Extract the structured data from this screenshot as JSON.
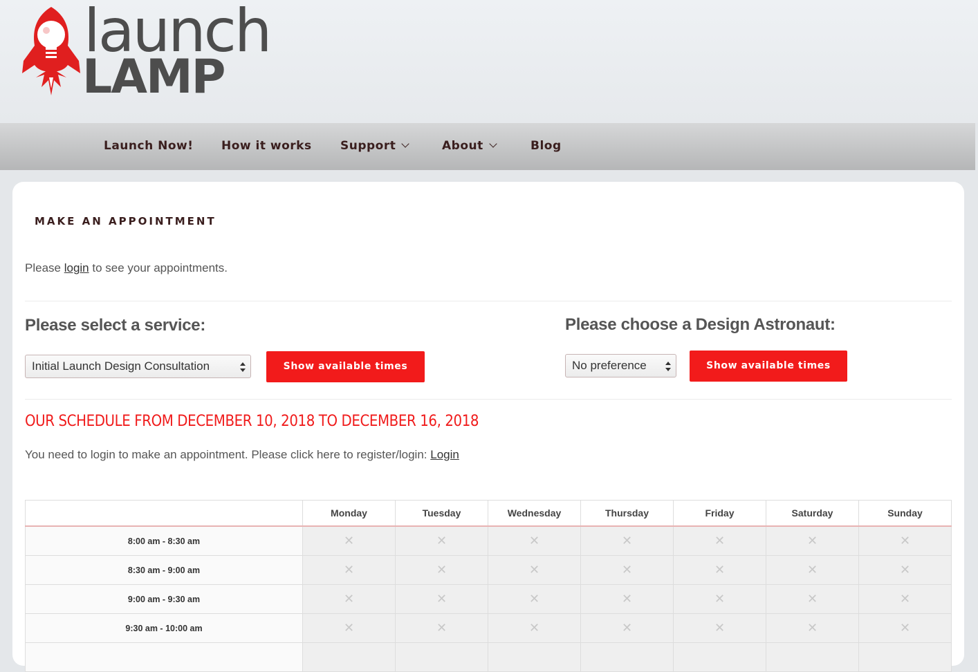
{
  "brand": {
    "line1": "launch",
    "line2": "LAMP"
  },
  "nav": {
    "items": [
      {
        "label": "Launch Now!"
      },
      {
        "label": "How it works"
      },
      {
        "label": "Support"
      },
      {
        "label": "About"
      },
      {
        "label": "Blog"
      }
    ]
  },
  "page": {
    "section_label": "MAKE AN APPOINTMENT",
    "login_prefix": "Please",
    "login_link": "login",
    "login_suffix": "to see your appointments."
  },
  "service": {
    "heading": "Please select a service:",
    "selected": "Initial Launch Design Consultation",
    "button": "Show available times"
  },
  "astronaut": {
    "heading": "Please choose a Design Astronaut:",
    "selected": "No preference",
    "button": "Show available times"
  },
  "schedule": {
    "title": "OUR SCHEDULE FROM DECEMBER 10, 2018 TO DECEMBER 16, 2018",
    "login_text": "You need to login to make an appointment. Please click here to register/login:",
    "login_link": "Login",
    "days": [
      "Monday",
      "Tuesday",
      "Wednesday",
      "Thursday",
      "Friday",
      "Saturday",
      "Sunday"
    ],
    "times": [
      "8:00 am - 8:30 am",
      "8:30 am - 9:00 am",
      "9:00 am - 9:30 am",
      "9:30 am - 10:00 am"
    ],
    "unavailable_mark": "✕"
  },
  "colors": {
    "accent": "#f21b1b",
    "nav_text": "#3a1e1e",
    "logo_red": "#e01f1f"
  }
}
